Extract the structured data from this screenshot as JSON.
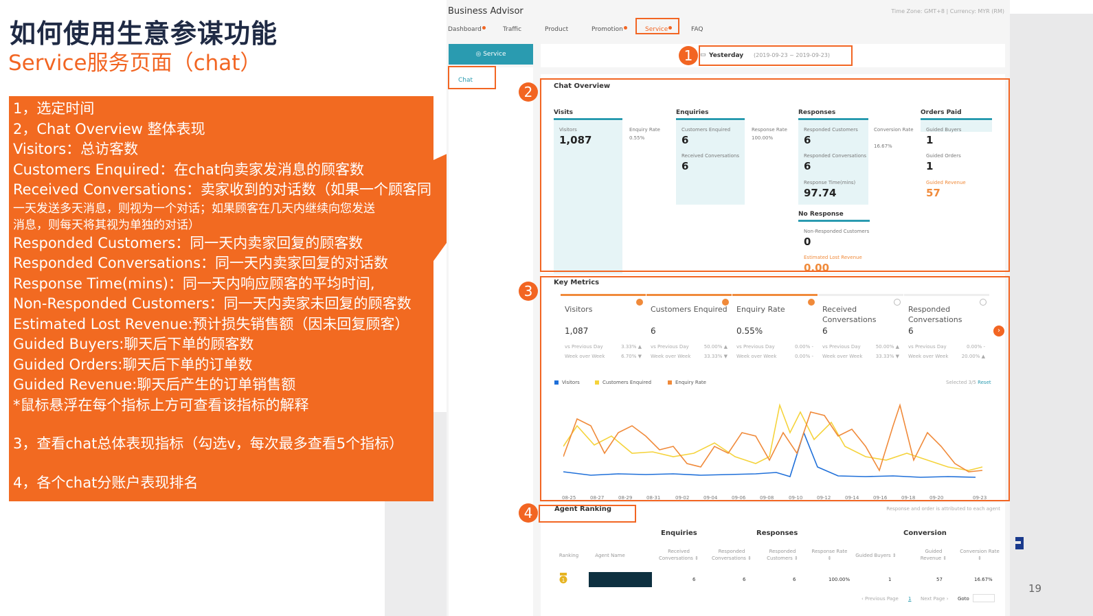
{
  "slide": {
    "title": "如何使用生意参谋功能",
    "subtitle": "Service服务页面（chat）",
    "page_number": "19"
  },
  "panel": {
    "lines": [
      "1，选定时间",
      "2，Chat Overview 整体表现",
      "Visitors：总访客数",
      "Customers Enquired：在chat向卖家发消息的顾客数",
      "Received Conversations：卖家收到的对话数（如果一个顾客同",
      "一天发送多天消息，则视为一个对话；如果顾客在几天内继续向您发送",
      "消息，则每天将其视为单独的对话）",
      "Responded Customers：同一天内卖家回复的顾客数",
      "Responded Conversations：同一天内卖家回复的对话数",
      "Response Time(mins)：同一天内响应顾客的平均时间,",
      "Non-Responded Customers：同一天内卖家未回复的顾客数",
      "Estimated Lost Revenue:预计损失销售额（因未回复顾客）",
      "Guided Buyers:聊天后下单的顾客数",
      "Guided Orders:聊天后下单的订单数",
      "Guided Revenue:聊天后产生的订单销售额",
      "*鼠标悬浮在每个指标上方可查看该指标的解释",
      "3，查看chat总体表现指标（勾选v，每次最多查看5个指标）",
      "4，各个chat分账户表现排名"
    ]
  },
  "ui": {
    "app_title": "Business Advisor",
    "timezone": "Time Zone: GMT+8 | Currency: MYR (RM)",
    "nav": [
      "Dashboard",
      "Traffic",
      "Product",
      "Promotion",
      "Service",
      "FAQ"
    ],
    "sidebar_service": "Service",
    "sidebar_chat": "Chat",
    "date_label": "Yesterday",
    "date_range": "(2019-09-23 ~ 2019-09-23)",
    "chat_overview": {
      "title": "Chat Overview",
      "groups": {
        "visits": "Visits",
        "enquiries": "Enquiries",
        "responses": "Responses",
        "orders": "Orders Paid",
        "no_response": "No Response"
      },
      "visitors_label": "Visitors",
      "visitors": "1,087",
      "enquiry_rate_label": "Enquiry Rate",
      "enquiry_rate": "0.55%",
      "cust_enq_label": "Customers Enquired",
      "cust_enq": "6",
      "recv_conv_label": "Received Conversations",
      "recv_conv": "6",
      "resp_rate_label": "Response Rate",
      "resp_rate": "100.00%",
      "resp_cust_label": "Responded Customers",
      "resp_cust": "6",
      "resp_conv_label": "Responded Conversations",
      "resp_conv": "6",
      "resp_time_label": "Response Time(mins)",
      "resp_time": "97.74",
      "conv_rate_label": "Conversion Rate",
      "conv_rate": "16.67%",
      "guided_buyers_label": "Guided Buyers",
      "guided_buyers": "1",
      "guided_orders_label": "Guided Orders",
      "guided_orders": "1",
      "guided_rev_label": "Guided Revenue",
      "guided_rev": "57",
      "non_resp_label": "Non-Responded Customers",
      "non_resp": "0",
      "lost_rev_label": "Estimated Lost Revenue",
      "lost_rev": "0.00"
    },
    "key_metrics": {
      "title": "Key Metrics",
      "cards": [
        {
          "name": "Visitors",
          "value": "1,087",
          "prev_label": "vs Previous Day",
          "prev": "3.33% ▲",
          "week_label": "Week over Week",
          "week": "6.70% ▼",
          "selected": true
        },
        {
          "name": "Customers Enquired",
          "value": "6",
          "prev_label": "vs Previous Day",
          "prev": "50.00% ▲",
          "week_label": "Week over Week",
          "week": "33.33% ▼",
          "selected": true
        },
        {
          "name": "Enquiry Rate",
          "value": "0.55%",
          "prev_label": "vs Previous Day",
          "prev": "0.00% -",
          "week_label": "Week over Week",
          "week": "0.00% -",
          "selected": true
        },
        {
          "name": "Received Conversations",
          "value": "6",
          "prev_label": "vs Previous Day",
          "prev": "50.00% ▲",
          "week_label": "Week over Week",
          "week": "33.33% ▼",
          "selected": false
        },
        {
          "name": "Responded Conversations",
          "value": "6",
          "prev_label": "vs Previous Day",
          "prev": "0.00% -",
          "week_label": "Week over Week",
          "week": "20.00% ▲",
          "selected": false
        }
      ],
      "legend": [
        "Visitors",
        "Customers Enquired",
        "Enquiry Rate"
      ],
      "legend_colors": [
        "#1e6fd9",
        "#f5d33b",
        "#f08a3a"
      ],
      "selected_text": "Selected 3/5",
      "reset": "Reset",
      "x_ticks": [
        "08-25",
        "08-27",
        "08-29",
        "08-31",
        "09-02",
        "09-04",
        "09-06",
        "09-08",
        "09-10",
        "09-12",
        "09-14",
        "09-16",
        "09-18",
        "09-20",
        "09-23"
      ]
    },
    "agent_ranking": {
      "title": "Agent Ranking",
      "note": "Response and order is attributed to each agent",
      "groups": [
        "Enquiries",
        "Responses",
        "Conversion"
      ],
      "columns": [
        "Ranking",
        "Agent Name",
        "Received Conversations ⇕",
        "Responded Conversations ⇕",
        "Responded Customers ⇕",
        "Response Rate ⇕",
        "Guided Buyers ⇕",
        "Guided Revenue ⇕",
        "Conversion Rate ⇕"
      ],
      "row": [
        "6",
        "6",
        "6",
        "100.00%",
        "1",
        "57",
        "16.67%"
      ],
      "pager": {
        "prev": "‹ Previous Page",
        "page": "1",
        "next": "Next Page ›",
        "goto": "Goto"
      }
    },
    "callout_numbers": [
      "1",
      "2",
      "3",
      "4"
    ]
  }
}
